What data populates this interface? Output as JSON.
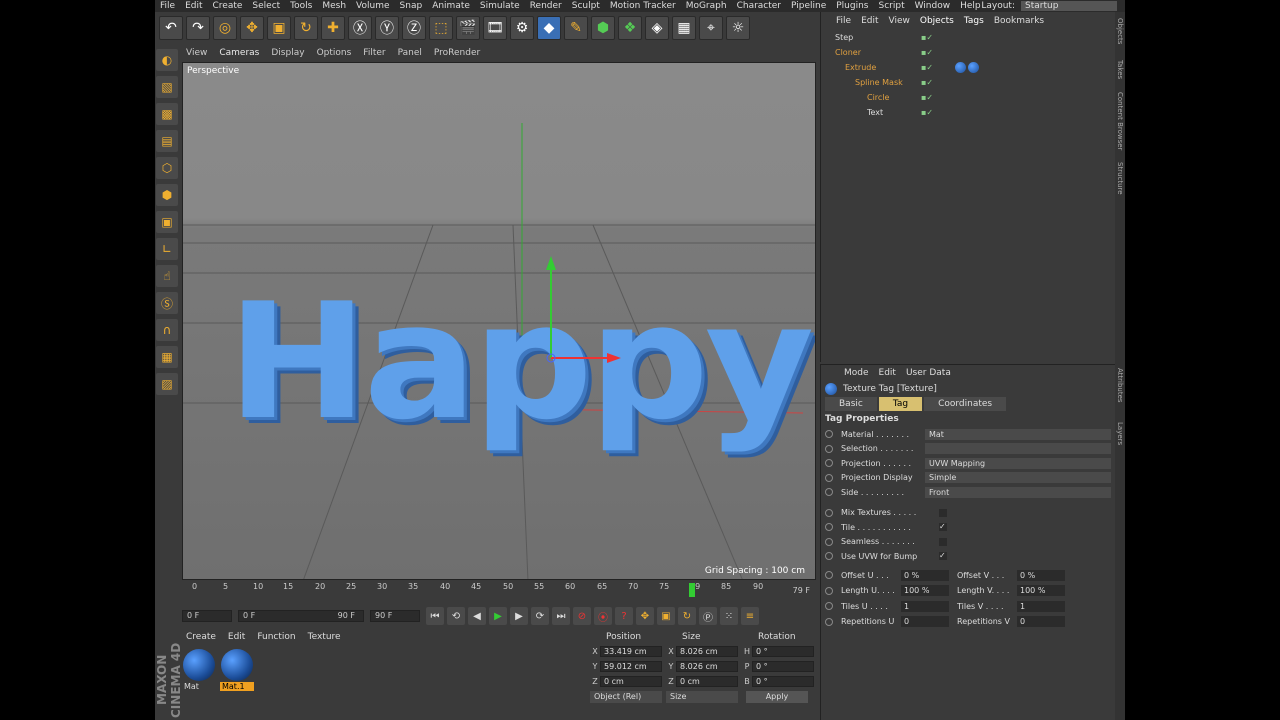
{
  "menu": [
    "File",
    "Edit",
    "Create",
    "Select",
    "Tools",
    "Mesh",
    "Volume",
    "Snap",
    "Animate",
    "Simulate",
    "Render",
    "Sculpt",
    "Motion Tracker",
    "MoGraph",
    "Character",
    "Pipeline",
    "Plugins",
    "Script",
    "Window",
    "Help"
  ],
  "layout": {
    "label": "Layout:",
    "value": "Startup"
  },
  "viewport_menu": [
    "View",
    "Cameras",
    "Display",
    "Options",
    "Filter",
    "Panel",
    "ProRender"
  ],
  "viewport": {
    "name": "Perspective",
    "grid_spacing": "Grid Spacing : 100 cm",
    "scene_text": "Happy"
  },
  "timeline": {
    "ticks": [
      "0",
      "5",
      "10",
      "15",
      "20",
      "25",
      "30",
      "35",
      "40",
      "45",
      "50",
      "55",
      "60",
      "65",
      "70",
      "75",
      "79",
      "85",
      "90"
    ],
    "current_frame": "79 F",
    "start": "0 F",
    "range_start": "0 F",
    "range_end": "90 F",
    "end": "90 F"
  },
  "material_menu": [
    "Create",
    "Edit",
    "Function",
    "Texture"
  ],
  "materials": [
    {
      "name": "Mat"
    },
    {
      "name": "Mat.1"
    }
  ],
  "coords": {
    "headers": [
      "Position",
      "Size",
      "Rotation"
    ],
    "rows": [
      {
        "a1": "X",
        "v1": "33.419 cm",
        "a2": "X",
        "v2": "8.026 cm",
        "a3": "H",
        "v3": "0 °"
      },
      {
        "a1": "Y",
        "v1": "59.012 cm",
        "a2": "Y",
        "v2": "8.026 cm",
        "a3": "P",
        "v3": "0 °"
      },
      {
        "a1": "Z",
        "v1": "0 cm",
        "a2": "Z",
        "v2": "0 cm",
        "a3": "B",
        "v3": "0 °"
      }
    ],
    "mode": "Object (Rel)",
    "size_mode": "Size",
    "apply": "Apply"
  },
  "object_menu": [
    "File",
    "Edit",
    "View",
    "Objects",
    "Tags",
    "Bookmarks"
  ],
  "objects": [
    {
      "name": "Step",
      "indent": 0
    },
    {
      "name": "Cloner",
      "indent": 0
    },
    {
      "name": "Extrude",
      "indent": 1
    },
    {
      "name": "Spline Mask",
      "indent": 2
    },
    {
      "name": "Circle",
      "indent": 3
    },
    {
      "name": "Text",
      "indent": 3
    }
  ],
  "attr_menu": [
    "Mode",
    "Edit",
    "User Data"
  ],
  "attr_title": "Texture Tag [Texture]",
  "attr_tabs": [
    "Basic",
    "Tag",
    "Coordinates"
  ],
  "tag_properties_title": "Tag Properties",
  "props": [
    {
      "label": "Material . . . . . . .",
      "value": "Mat"
    },
    {
      "label": "Selection . . . . . . .",
      "value": ""
    },
    {
      "label": "Projection . . . . . .",
      "value": "UVW Mapping"
    },
    {
      "label": "Projection Display",
      "value": "Simple"
    },
    {
      "label": "Side . . . . . . . . .",
      "value": "Front"
    }
  ],
  "checks": [
    {
      "label": "Mix Textures . . . . .",
      "value": ""
    },
    {
      "label": "Tile . . . . . . . . . . .",
      "value": "✓"
    },
    {
      "label": "Seamless . . . . . . .",
      "value": ""
    },
    {
      "label": "Use UVW for Bump",
      "value": "✓"
    }
  ],
  "offsets": [
    {
      "l1": "Offset U . . .",
      "v1": "0 %",
      "l2": "Offset V . . .",
      "v2": "0 %"
    },
    {
      "l1": "Length U. . . .",
      "v1": "100 %",
      "l2": "Length V. . . .",
      "v2": "100 %"
    },
    {
      "l1": "Tiles U . . . .",
      "v1": "1",
      "l2": "Tiles V . . . .",
      "v2": "1"
    },
    {
      "l1": "Repetitions U",
      "v1": "0",
      "l2": "Repetitions V",
      "v2": "0"
    }
  ],
  "side_tabs": [
    "Objects",
    "Takes",
    "Content Browser",
    "Structure",
    "Attributes",
    "Layers"
  ],
  "logo": "MAXON CINEMA 4D"
}
